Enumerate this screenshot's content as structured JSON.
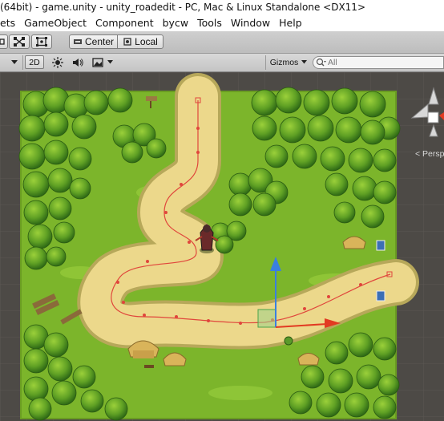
{
  "window": {
    "title": "(64bit) - game.unity - unity_roadedit - PC, Mac & Linux Standalone <DX11>"
  },
  "menu": {
    "items": [
      "ets",
      "GameObject",
      "Component",
      "bycw",
      "Tools",
      "Window",
      "Help"
    ]
  },
  "toolbar": {
    "center_label": "Center",
    "local_label": "Local"
  },
  "scene_toolbar": {
    "mode_2d": "2D",
    "gizmos_label": "Gizmos",
    "search_placeholder": "All"
  },
  "gizmo": {
    "projection_label": "< Persp"
  },
  "colors": {
    "grass": "#7cb52b",
    "dark_grass": "#4f8c1f",
    "road": "#ecd88b",
    "path_line": "#e0463c",
    "move_y": "#3a7fe0",
    "move_x": "#e23a22"
  }
}
